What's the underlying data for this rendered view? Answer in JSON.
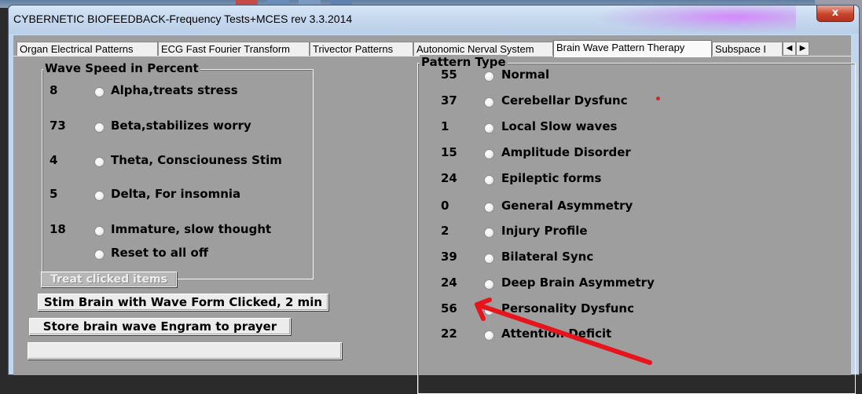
{
  "window": {
    "title": "CYBERNETIC BIOFEEDBACK-Frequency Tests+MCES rev 3.3.2014",
    "close_glyph": "x"
  },
  "tabs": [
    {
      "label": "Organ Electrical Patterns"
    },
    {
      "label": "ECG Fast Fourier Transform"
    },
    {
      "label": "Trivector Patterns"
    },
    {
      "label": "Autonomic Nerval System"
    },
    {
      "label": "Brain Wave Pattern Therapy",
      "active": true
    },
    {
      "label": "Subspace I"
    }
  ],
  "tab_scroll": {
    "left": "◀",
    "right": "▶"
  },
  "wave_speed": {
    "title": "Wave Speed in Percent",
    "items": [
      {
        "value": "8",
        "label": "Alpha,treats stress"
      },
      {
        "value": "73",
        "label": "Beta,stabilizes worry"
      },
      {
        "value": "4",
        "label": "Theta, Consciouness Stim"
      },
      {
        "value": "5",
        "label": "Delta, For insomnia"
      },
      {
        "value": "18",
        "label": "Immature, slow thought"
      },
      {
        "value": "",
        "label": "Reset to all off"
      }
    ]
  },
  "pattern_type": {
    "title": "Pattern Type",
    "items": [
      {
        "value": "55",
        "label": "Normal"
      },
      {
        "value": "37",
        "label": "Cerebellar Dysfunc"
      },
      {
        "value": "1",
        "label": "Local Slow waves"
      },
      {
        "value": "15",
        "label": "Amplitude Disorder"
      },
      {
        "value": "24",
        "label": "Epileptic forms"
      },
      {
        "value": "0",
        "label": "General Asymmetry"
      },
      {
        "value": "2",
        "label": "Injury Profile"
      },
      {
        "value": "39",
        "label": "Bilateral Sync"
      },
      {
        "value": "24",
        "label": "Deep Brain Asymmetry"
      },
      {
        "value": "56",
        "label": "Personality Dysfunc"
      },
      {
        "value": "22",
        "label": "Attention Deficit"
      }
    ]
  },
  "buttons": {
    "treat": "Treat clicked items",
    "stim": "Stim Brain with Wave Form Clicked, 2 min",
    "store": "Store brain wave Engram to prayer"
  },
  "annotation": {
    "color": "#e8141b"
  }
}
